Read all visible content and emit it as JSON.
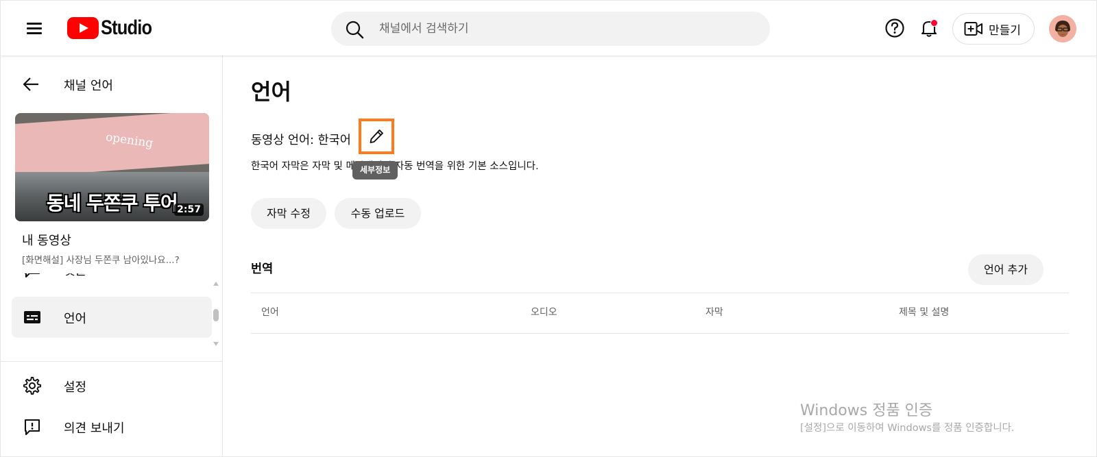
{
  "header": {
    "logo_text": "Studio",
    "search_placeholder": "채널에서 검색하기",
    "create_label": "만들기"
  },
  "sidebar": {
    "back_label": "채널 언어",
    "thumbnail": {
      "sign_text": "opening",
      "caption": "동네 두쫀쿠 투어",
      "duration": "2:57"
    },
    "my_video_label": "내 동영상",
    "video_title": "[화면해설] 사장님 두쫀쿠 남아있나요...?",
    "nav_items": [
      {
        "label": "댓글",
        "icon": "comment-icon"
      },
      {
        "label": "언어",
        "icon": "subtitles-icon",
        "active": true
      }
    ],
    "bottom_items": [
      {
        "label": "설정",
        "icon": "gear-icon"
      },
      {
        "label": "의견 보내기",
        "icon": "feedback-icon"
      }
    ]
  },
  "main": {
    "title": "언어",
    "video_language": "동영상 언어: 한국어",
    "tooltip": "세부정보",
    "description": "한국어 자막은 자막 및 메타데이터 자동 번역을 위한 기본 소스입니다.",
    "buttons": {
      "edit_subtitles": "자막 수정",
      "manual_upload": "수동 업로드"
    },
    "translations_label": "번역",
    "add_language": "언어 추가",
    "table_headers": [
      "언어",
      "오디오",
      "자막",
      "제목 및 설명"
    ]
  },
  "watermark": {
    "title": "Windows 정품 인증",
    "subtitle": "[설정]으로 이동하여 Windows를 정품 인증합니다."
  },
  "colors": {
    "brand_red": "#ff0000",
    "highlight_orange": "#ff7a1a",
    "notification_dot": "#ff0033",
    "pill_bg": "#f2f2f2"
  }
}
